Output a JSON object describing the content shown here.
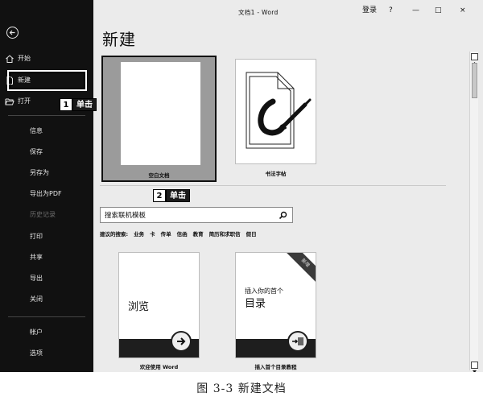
{
  "titlebar": {
    "doc_title": "文档1 - Word",
    "login": "登录",
    "help": "?",
    "minimize": "—",
    "restore": "□",
    "close": "×"
  },
  "sidebar": {
    "back_icon": "back-arrow-circle-icon",
    "items": [
      {
        "label": "开始",
        "icon": "home-icon"
      },
      {
        "label": "新建",
        "icon": "new-document-icon",
        "selected": true
      },
      {
        "label": "打开",
        "icon": "open-folder-icon"
      },
      {
        "label": "信息"
      },
      {
        "label": "保存"
      },
      {
        "label": "另存为"
      },
      {
        "label": "导出为PDF"
      },
      {
        "label": "历史记录",
        "disabled": true
      },
      {
        "label": "打印"
      },
      {
        "label": "共享"
      },
      {
        "label": "导出"
      },
      {
        "label": "关闭"
      },
      {
        "label": "帐户"
      },
      {
        "label": "选项"
      }
    ]
  },
  "callouts": [
    {
      "number": "1",
      "text": "单击"
    },
    {
      "number": "2",
      "text": "单击"
    }
  ],
  "main": {
    "heading": "新建",
    "templates": [
      {
        "caption": "空白文档"
      },
      {
        "caption": "书法字帖"
      }
    ],
    "search": {
      "value": "搜索联机模板",
      "icon": "search-icon"
    },
    "suggested": {
      "label": "建议的搜索:",
      "items": [
        "业务",
        "卡",
        "传单",
        "信函",
        "教育",
        "简历和求职信",
        "假日"
      ]
    },
    "cards": [
      {
        "big_text": "浏览",
        "caption": "欢迎使用 Word",
        "icon": "arrow-right-icon"
      },
      {
        "small_text": "插入你的首个",
        "big_text": "目录",
        "ribbon": "新增",
        "caption": "插入首个目录教程",
        "icon": "insert-toc-icon"
      }
    ]
  },
  "figure_caption": "图 3-3    新建文档"
}
